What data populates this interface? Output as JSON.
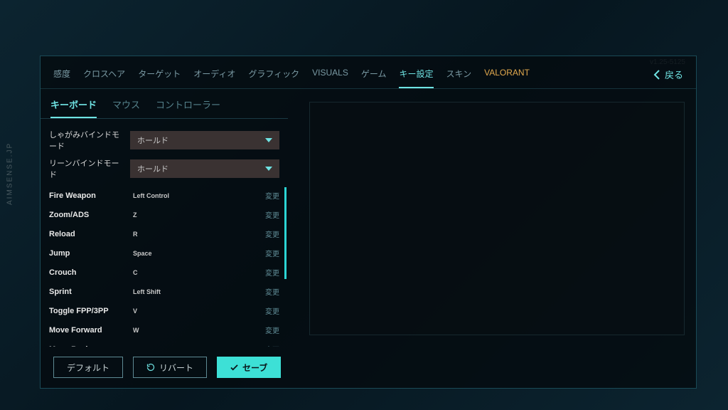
{
  "watermark": "AIMSENSE.JP",
  "version": "v1.25-5125",
  "main_tabs": [
    {
      "label": "感度"
    },
    {
      "label": "クロスヘア"
    },
    {
      "label": "ターゲット"
    },
    {
      "label": "オーディオ"
    },
    {
      "label": "グラフィック"
    },
    {
      "label": "VISUALS"
    },
    {
      "label": "ゲーム"
    },
    {
      "label": "キー設定",
      "active": true
    },
    {
      "label": "スキン"
    },
    {
      "label": "VALORANT",
      "brand": true
    }
  ],
  "back_label": "戻る",
  "sub_tabs": [
    {
      "label": "キーボード",
      "active": true
    },
    {
      "label": "マウス"
    },
    {
      "label": "コントローラー"
    }
  ],
  "modes": [
    {
      "label": "しゃがみバインドモード",
      "value": "ホールド"
    },
    {
      "label": "リーンバインドモード",
      "value": "ホールド"
    }
  ],
  "change_label": "変更",
  "bindings": [
    {
      "action": "Fire Weapon",
      "key": "Left Control"
    },
    {
      "action": "Zoom/ADS",
      "key": "Z"
    },
    {
      "action": "Reload",
      "key": "R"
    },
    {
      "action": "Jump",
      "key": "Space"
    },
    {
      "action": "Crouch",
      "key": "C"
    },
    {
      "action": "Sprint",
      "key": "Left Shift"
    },
    {
      "action": "Toggle FPP/3PP",
      "key": "V"
    },
    {
      "action": "Move Forward",
      "key": "W"
    },
    {
      "action": "Move Back",
      "key": "S"
    }
  ],
  "footer": {
    "default": "デフォルト",
    "revert": "リバート",
    "save": "セーブ"
  }
}
